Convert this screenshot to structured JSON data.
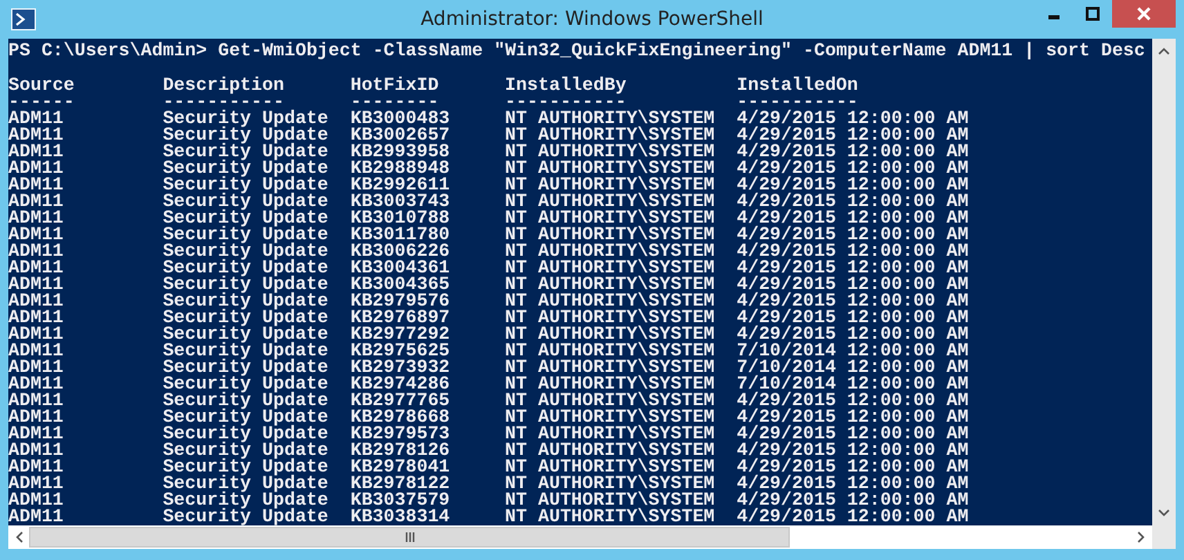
{
  "window": {
    "title": "Administrator: Windows PowerShell"
  },
  "console": {
    "command": "PS C:\\Users\\Admin> Get-WmiObject -ClassName \"Win32_QuickFixEngineering\" -ComputerName ADM11 | sort Desc",
    "columns": [
      {
        "label": "Source",
        "underline": "------"
      },
      {
        "label": "Description",
        "underline": "-----------"
      },
      {
        "label": "HotFixID",
        "underline": "--------"
      },
      {
        "label": "InstalledBy",
        "underline": "-----------"
      },
      {
        "label": "InstalledOn",
        "underline": "-----------"
      }
    ],
    "rows": [
      [
        "ADM11",
        "Security Update",
        "KB3000483",
        "NT AUTHORITY\\SYSTEM",
        "4/29/2015 12:00:00 AM"
      ],
      [
        "ADM11",
        "Security Update",
        "KB3002657",
        "NT AUTHORITY\\SYSTEM",
        "4/29/2015 12:00:00 AM"
      ],
      [
        "ADM11",
        "Security Update",
        "KB2993958",
        "NT AUTHORITY\\SYSTEM",
        "4/29/2015 12:00:00 AM"
      ],
      [
        "ADM11",
        "Security Update",
        "KB2988948",
        "NT AUTHORITY\\SYSTEM",
        "4/29/2015 12:00:00 AM"
      ],
      [
        "ADM11",
        "Security Update",
        "KB2992611",
        "NT AUTHORITY\\SYSTEM",
        "4/29/2015 12:00:00 AM"
      ],
      [
        "ADM11",
        "Security Update",
        "KB3003743",
        "NT AUTHORITY\\SYSTEM",
        "4/29/2015 12:00:00 AM"
      ],
      [
        "ADM11",
        "Security Update",
        "KB3010788",
        "NT AUTHORITY\\SYSTEM",
        "4/29/2015 12:00:00 AM"
      ],
      [
        "ADM11",
        "Security Update",
        "KB3011780",
        "NT AUTHORITY\\SYSTEM",
        "4/29/2015 12:00:00 AM"
      ],
      [
        "ADM11",
        "Security Update",
        "KB3006226",
        "NT AUTHORITY\\SYSTEM",
        "4/29/2015 12:00:00 AM"
      ],
      [
        "ADM11",
        "Security Update",
        "KB3004361",
        "NT AUTHORITY\\SYSTEM",
        "4/29/2015 12:00:00 AM"
      ],
      [
        "ADM11",
        "Security Update",
        "KB3004365",
        "NT AUTHORITY\\SYSTEM",
        "4/29/2015 12:00:00 AM"
      ],
      [
        "ADM11",
        "Security Update",
        "KB2979576",
        "NT AUTHORITY\\SYSTEM",
        "4/29/2015 12:00:00 AM"
      ],
      [
        "ADM11",
        "Security Update",
        "KB2976897",
        "NT AUTHORITY\\SYSTEM",
        "4/29/2015 12:00:00 AM"
      ],
      [
        "ADM11",
        "Security Update",
        "KB2977292",
        "NT AUTHORITY\\SYSTEM",
        "4/29/2015 12:00:00 AM"
      ],
      [
        "ADM11",
        "Security Update",
        "KB2975625",
        "NT AUTHORITY\\SYSTEM",
        "7/10/2014 12:00:00 AM"
      ],
      [
        "ADM11",
        "Security Update",
        "KB2973932",
        "NT AUTHORITY\\SYSTEM",
        "7/10/2014 12:00:00 AM"
      ],
      [
        "ADM11",
        "Security Update",
        "KB2974286",
        "NT AUTHORITY\\SYSTEM",
        "7/10/2014 12:00:00 AM"
      ],
      [
        "ADM11",
        "Security Update",
        "KB2977765",
        "NT AUTHORITY\\SYSTEM",
        "4/29/2015 12:00:00 AM"
      ],
      [
        "ADM11",
        "Security Update",
        "KB2978668",
        "NT AUTHORITY\\SYSTEM",
        "4/29/2015 12:00:00 AM"
      ],
      [
        "ADM11",
        "Security Update",
        "KB2979573",
        "NT AUTHORITY\\SYSTEM",
        "4/29/2015 12:00:00 AM"
      ],
      [
        "ADM11",
        "Security Update",
        "KB2978126",
        "NT AUTHORITY\\SYSTEM",
        "4/29/2015 12:00:00 AM"
      ],
      [
        "ADM11",
        "Security Update",
        "KB2978041",
        "NT AUTHORITY\\SYSTEM",
        "4/29/2015 12:00:00 AM"
      ],
      [
        "ADM11",
        "Security Update",
        "KB2978122",
        "NT AUTHORITY\\SYSTEM",
        "4/29/2015 12:00:00 AM"
      ],
      [
        "ADM11",
        "Security Update",
        "KB3037579",
        "NT AUTHORITY\\SYSTEM",
        "4/29/2015 12:00:00 AM"
      ],
      [
        "ADM11",
        "Security Update",
        "KB3038314",
        "NT AUTHORITY\\SYSTEM",
        "4/29/2015 12:00:00 AM"
      ]
    ]
  }
}
